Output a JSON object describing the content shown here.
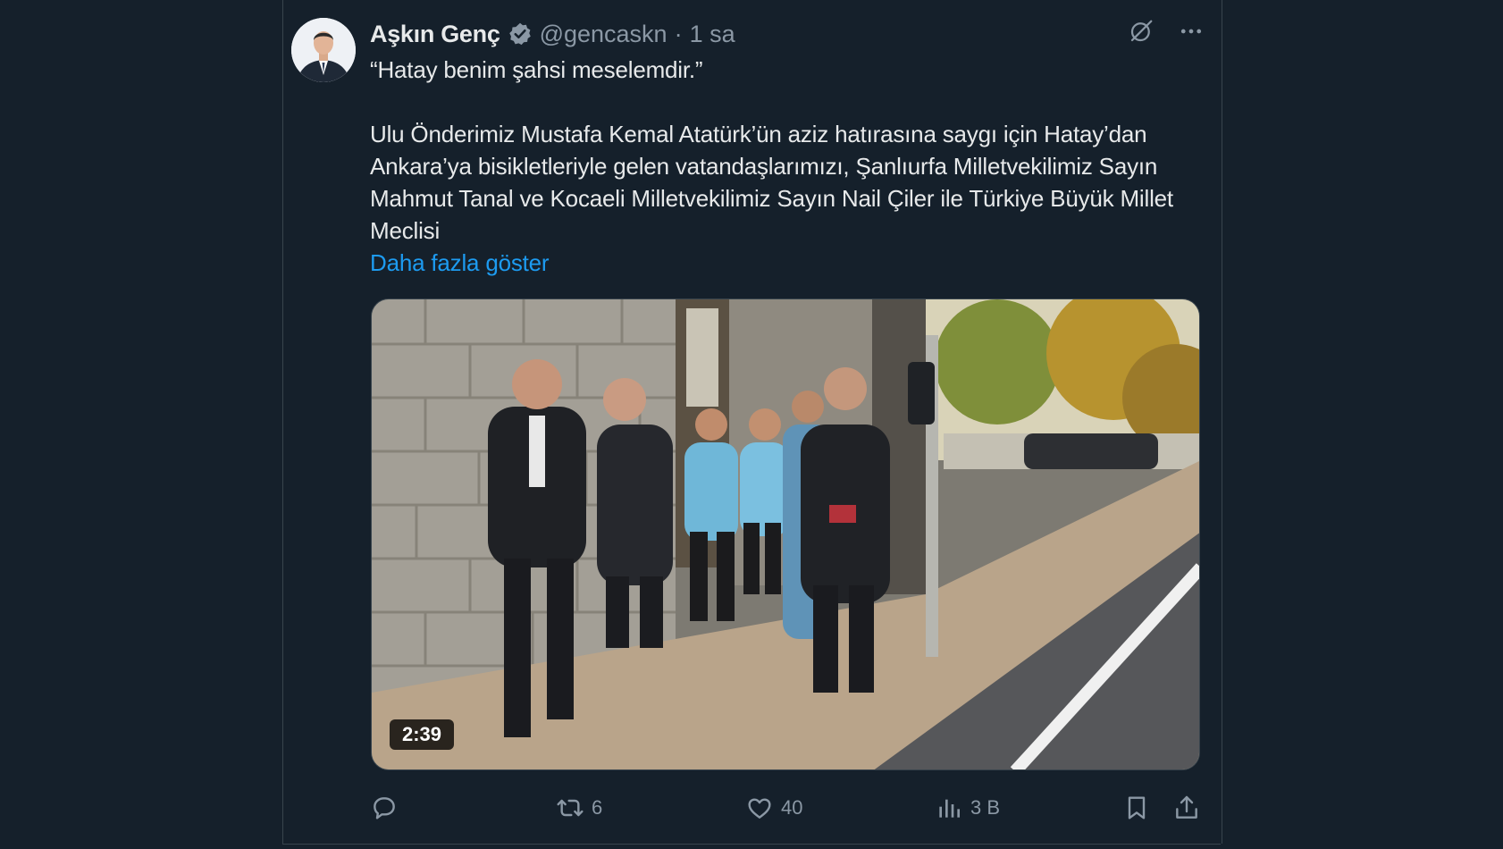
{
  "tweet": {
    "author_name": "Aşkın Genç",
    "handle": "@gencaskn",
    "separator": "·",
    "time": "1 sa",
    "paragraphs": [
      "“Hatay benim şahsi meselemdir.”",
      "Ulu Önderimiz Mustafa Kemal Atatürk’ün aziz hatırasına saygı için Hatay’dan Ankara’ya bisikletleriyle gelen vatandaşlarımızı, Şanlıurfa Milletvekilimiz Sayın Mahmut Tanal ve Kocaeli Milletvekilimiz Sayın Nail Çiler ile Türkiye Büyük Millet Meclisi"
    ],
    "show_more": "Daha fazla göster",
    "video": {
      "duration": "2:39"
    }
  },
  "actions": {
    "reply_count": "",
    "retweet_count": "6",
    "like_count": "40",
    "views_count": "3 B"
  },
  "icons": {
    "verified": "verified-badge-icon",
    "grok": "grok-icon",
    "more": "more-icon",
    "reply": "reply-icon",
    "retweet": "retweet-icon",
    "like": "heart-icon",
    "views": "views-icon",
    "bookmark": "bookmark-icon",
    "share": "share-icon"
  },
  "colors": {
    "background": "#15202b",
    "text": "#e7e9ea",
    "muted": "#8b98a5",
    "link": "#1d9bf0",
    "border": "#38444d"
  }
}
